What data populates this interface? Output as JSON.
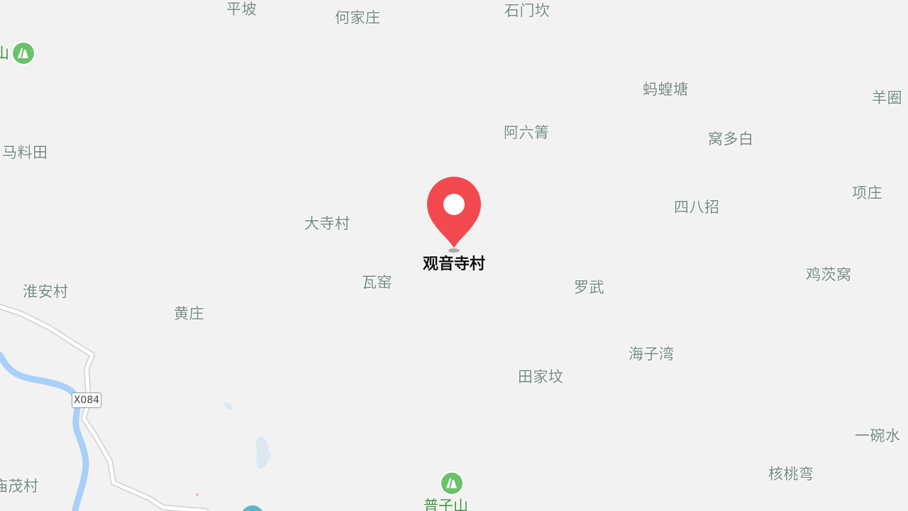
{
  "map": {
    "selected": {
      "label": "观音寺村",
      "marker_color": "#f24a4f"
    },
    "places": [
      {
        "name": "平坡"
      },
      {
        "name": "何家庄"
      },
      {
        "name": "石门坎"
      },
      {
        "name": "蚂蝗塘"
      },
      {
        "name": "羊圈"
      },
      {
        "name": "阿六箐"
      },
      {
        "name": "窝多白"
      },
      {
        "name": "马料田"
      },
      {
        "name": "项庄"
      },
      {
        "name": "四八招"
      },
      {
        "name": "大寺村"
      },
      {
        "name": "瓦窑"
      },
      {
        "name": "罗武"
      },
      {
        "name": "鸡茨窝"
      },
      {
        "name": "淮安村"
      },
      {
        "name": "黄庄"
      },
      {
        "name": "海子湾"
      },
      {
        "name": "田家坟"
      },
      {
        "name": "一碗水"
      },
      {
        "name": "核桃弯"
      },
      {
        "name": "庙茂村"
      }
    ],
    "mountains": [
      {
        "name": "山"
      },
      {
        "name": "普子山"
      }
    ],
    "road_shield": "X084",
    "colors": {
      "background": "#f2f2f2",
      "road": "#ffffff",
      "road_edge": "#cfcfcf",
      "river": "#a8d0f8",
      "place_text": "#758a86",
      "mountain_icon": "#6ac26a"
    }
  }
}
